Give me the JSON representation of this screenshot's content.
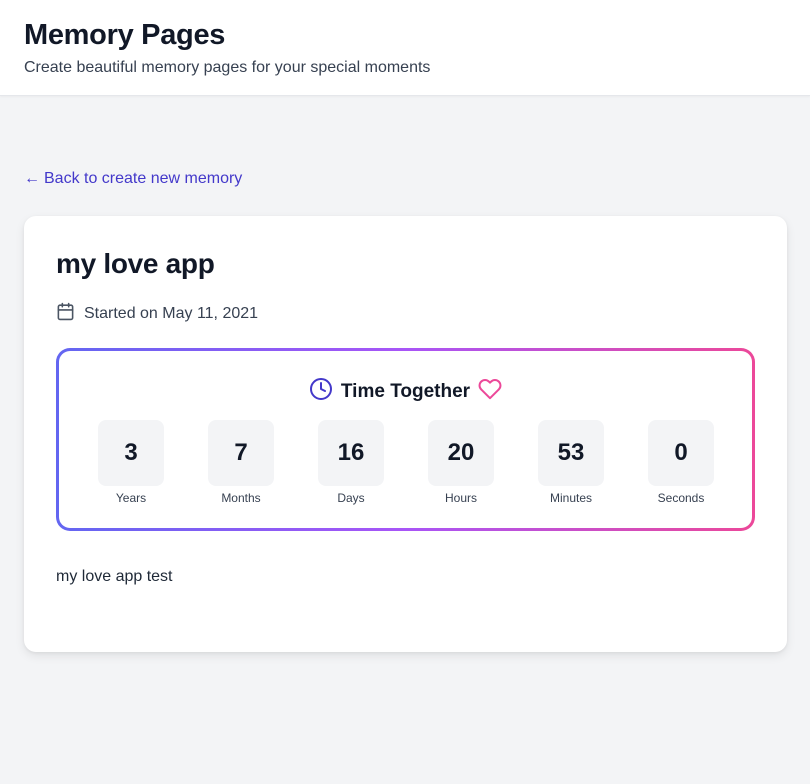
{
  "header": {
    "title": "Memory Pages",
    "subtitle": "Create beautiful memory pages for your special moments"
  },
  "back_link": {
    "arrow": "←",
    "label": "Back to create new memory"
  },
  "memory": {
    "title": "my love app",
    "started": "Started on May 11, 2021",
    "description": "my love app test"
  },
  "timer": {
    "heading": "Time Together",
    "units": [
      {
        "value": "3",
        "label": "Years"
      },
      {
        "value": "7",
        "label": "Months"
      },
      {
        "value": "16",
        "label": "Days"
      },
      {
        "value": "20",
        "label": "Hours"
      },
      {
        "value": "53",
        "label": "Minutes"
      },
      {
        "value": "0",
        "label": "Seconds"
      }
    ]
  },
  "colors": {
    "accent": "#4338ca",
    "gradient_start": "#6366f1",
    "gradient_mid": "#a855f7",
    "gradient_end": "#ec4899",
    "heart": "#ec4899"
  },
  "icons": {
    "calendar": "calendar-icon",
    "clock": "clock-icon",
    "heart": "heart-icon"
  }
}
